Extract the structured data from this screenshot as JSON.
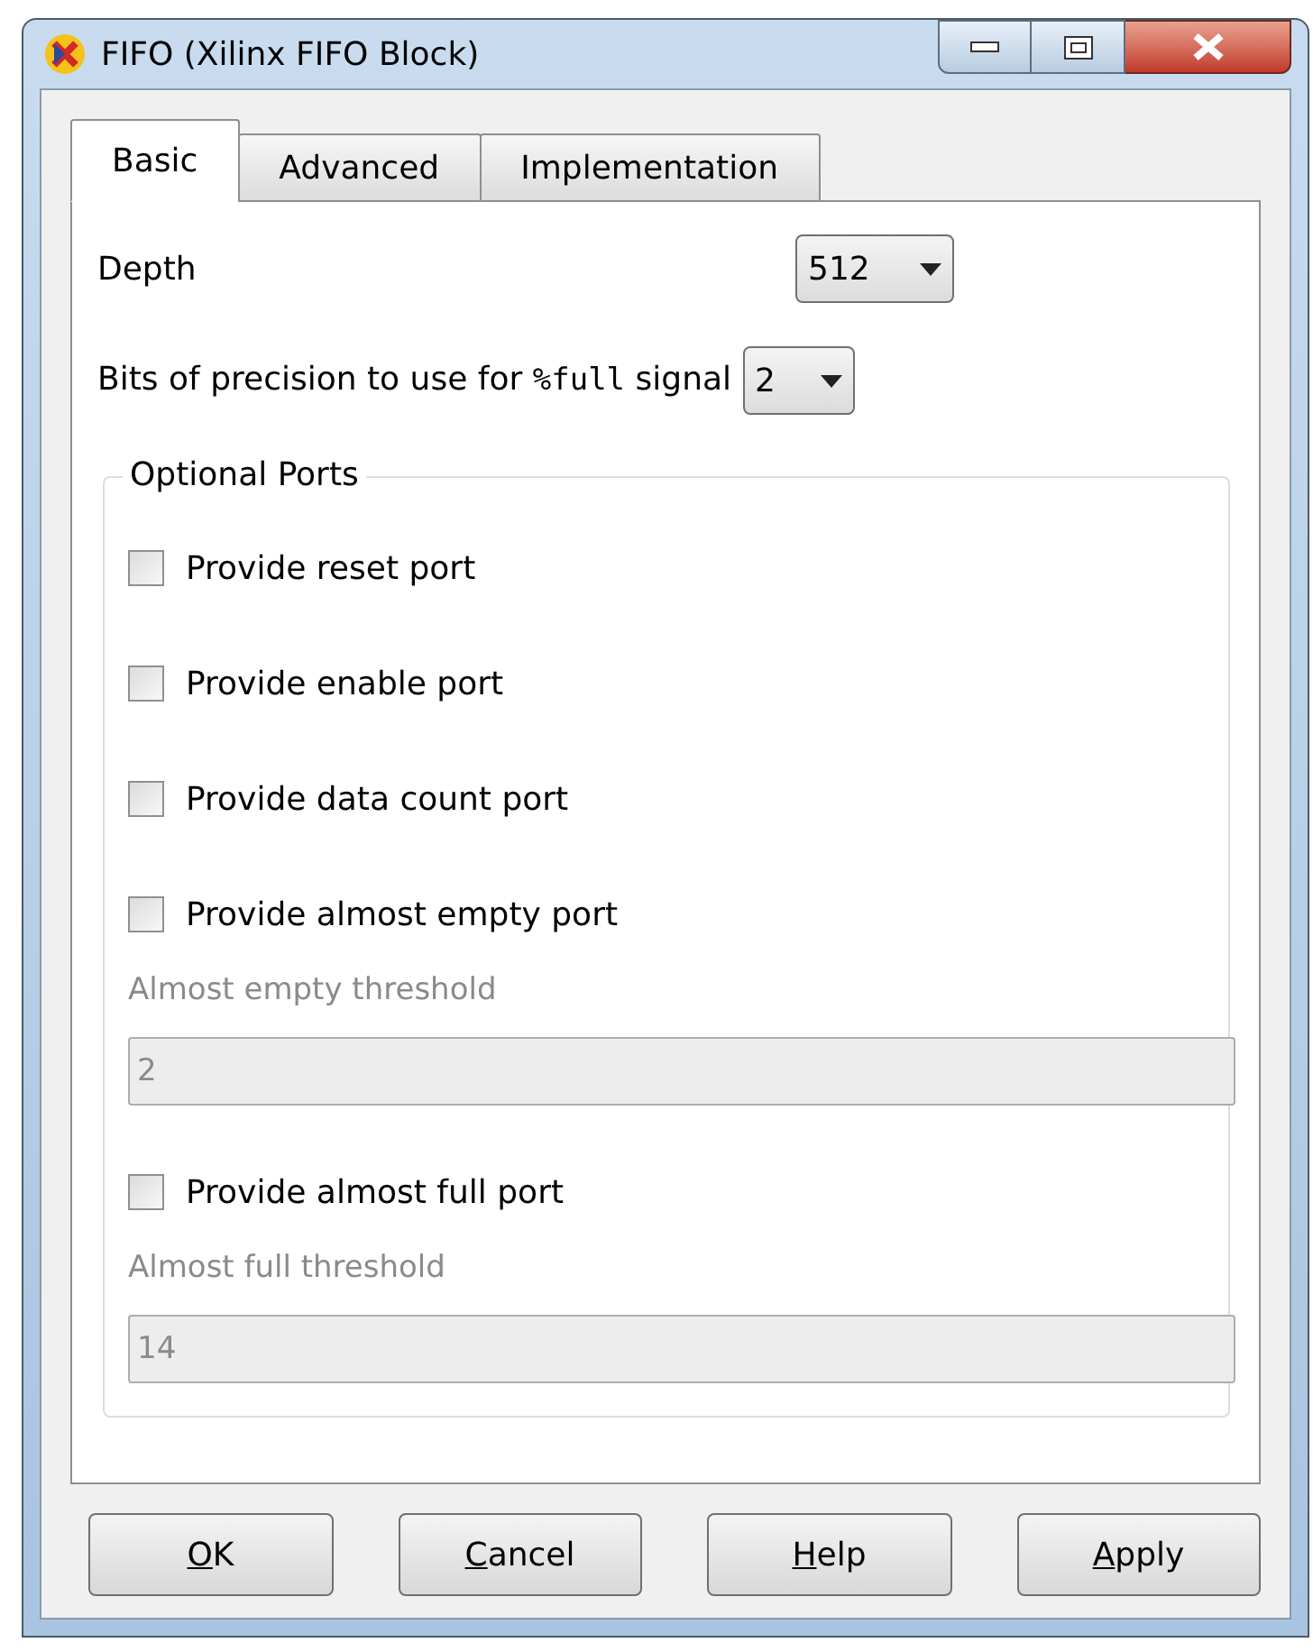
{
  "window": {
    "title": "FIFO (Xilinx FIFO Block)"
  },
  "tabs": [
    {
      "label": "Basic",
      "selected": true
    },
    {
      "label": "Advanced",
      "selected": false
    },
    {
      "label": "Implementation",
      "selected": false
    }
  ],
  "depth": {
    "label": "Depth",
    "value": "512"
  },
  "precision": {
    "label_before": "Bits of precision to use for ",
    "code": "%full",
    "label_after": " signal",
    "value": "2"
  },
  "optional_ports": {
    "title": "Optional Ports",
    "items": [
      {
        "kind": "checkbox",
        "label": "Provide reset port",
        "checked": false
      },
      {
        "kind": "checkbox",
        "label": "Provide enable port",
        "checked": false
      },
      {
        "kind": "checkbox",
        "label": "Provide data count port",
        "checked": false
      },
      {
        "kind": "checkbox",
        "label": "Provide almost empty port",
        "checked": false
      },
      {
        "kind": "field",
        "label": "Almost empty threshold",
        "value": "2",
        "disabled": true
      },
      {
        "kind": "checkbox",
        "label": "Provide almost full port",
        "checked": false
      },
      {
        "kind": "field",
        "label": "Almost full threshold",
        "value": "14",
        "disabled": true
      }
    ]
  },
  "buttons": [
    {
      "accel": "O",
      "rest": "K"
    },
    {
      "accel": "C",
      "rest": "ancel"
    },
    {
      "accel": "H",
      "rest": "elp"
    },
    {
      "accel": "A",
      "rest": "pply"
    }
  ]
}
